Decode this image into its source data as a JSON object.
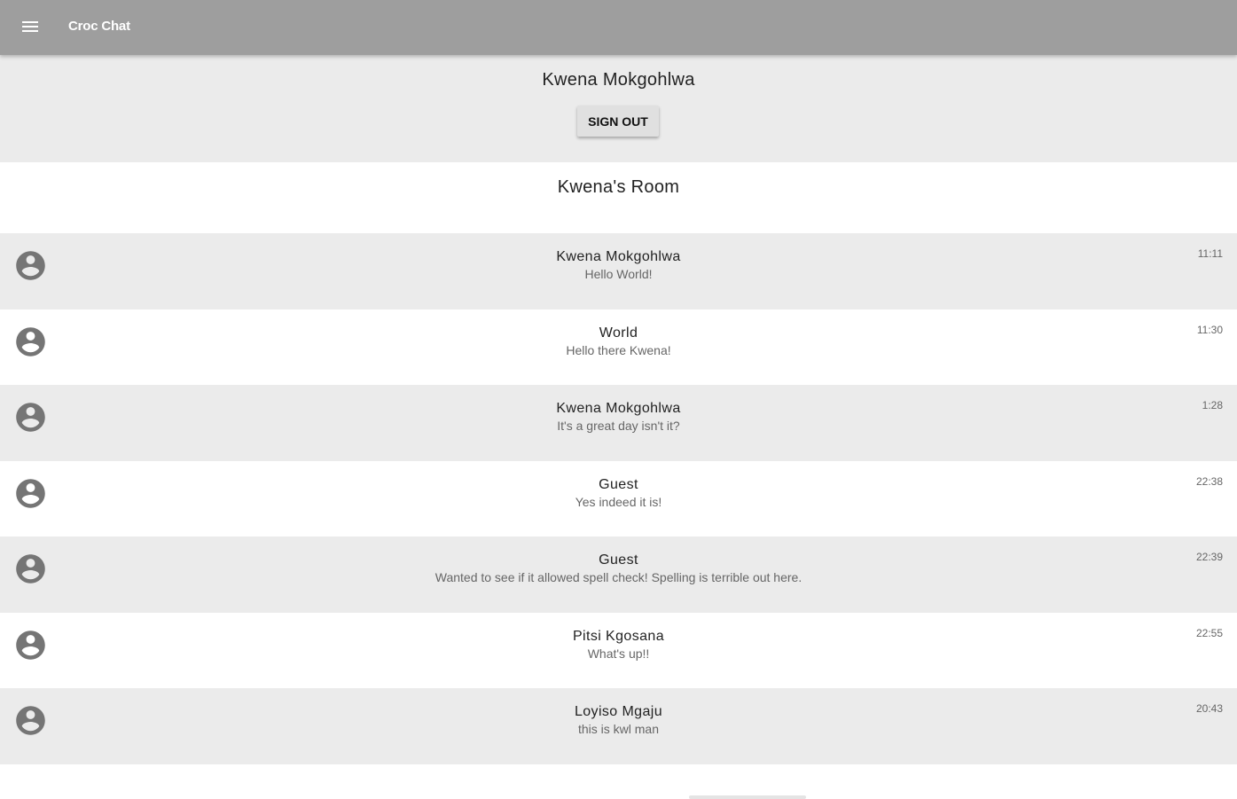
{
  "app": {
    "title": "Croc Chat",
    "menu_icon": "hamburger-menu-icon"
  },
  "user_panel": {
    "name": "Kwena Mokgohlwa",
    "signout_label": "SIGN OUT"
  },
  "room": {
    "title": "Kwena's Room"
  },
  "messages": [
    {
      "sender": "Kwena Mokgohlwa",
      "text": "Hello World!",
      "time": "11:11",
      "avatar_icon": "account-circle-icon"
    },
    {
      "sender": "World",
      "text": "Hello there Kwena!",
      "time": "11:30",
      "avatar_icon": "account-circle-icon"
    },
    {
      "sender": "Kwena Mokgohlwa",
      "text": "It's a great day isn't it?",
      "time": "1:28",
      "avatar_icon": "account-circle-icon"
    },
    {
      "sender": "Guest",
      "text": "Yes indeed it is!",
      "time": "22:38",
      "avatar_icon": "account-circle-icon"
    },
    {
      "sender": "Guest",
      "text": "Wanted to see if it allowed spell check! Spelling is terrible out here.",
      "time": "22:39",
      "avatar_icon": "account-circle-icon"
    },
    {
      "sender": "Pitsi Kgosana",
      "text": "What's up!!",
      "time": "22:55",
      "avatar_icon": "account-circle-icon"
    },
    {
      "sender": "Loyiso Mgaju",
      "text": "this is kwl man",
      "time": "20:43",
      "avatar_icon": "account-circle-icon"
    }
  ],
  "colors": {
    "app_bar": "#9e9e9e",
    "panel_bg": "#ebebeb",
    "avatar": "#757575"
  }
}
